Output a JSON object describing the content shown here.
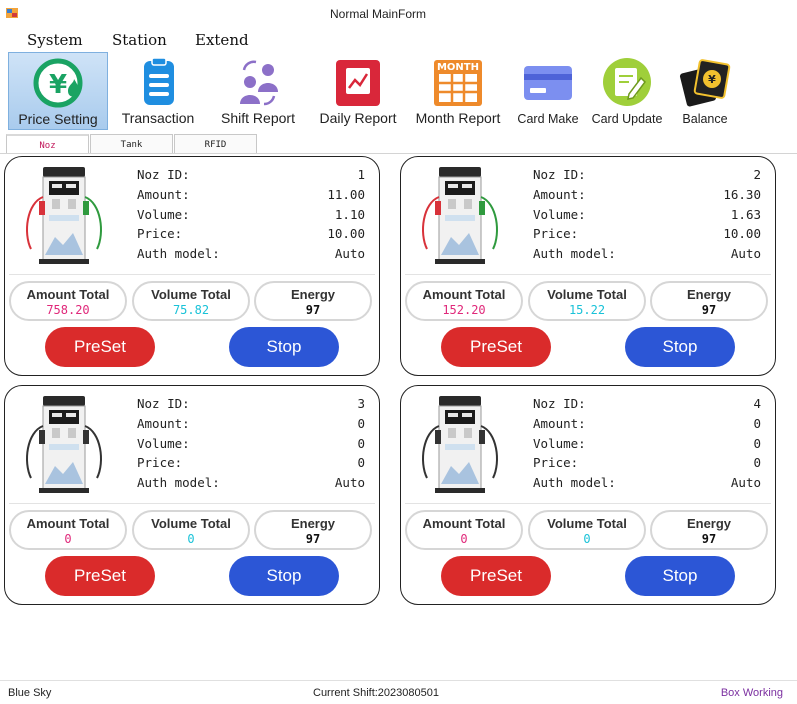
{
  "window": {
    "title": "Normal MainForm"
  },
  "menu": [
    "System",
    "Station",
    "Extend"
  ],
  "toolbar": [
    {
      "label": "Price Setting",
      "icon": "price-setting-icon"
    },
    {
      "label": "Transaction",
      "icon": "transaction-icon"
    },
    {
      "label": "Shift Report",
      "icon": "shift-report-icon"
    },
    {
      "label": "Daily Report",
      "icon": "daily-report-icon"
    },
    {
      "label": "Month Report",
      "icon": "month-report-icon",
      "badge": "MONTH"
    },
    {
      "label": "Card Make",
      "icon": "card-make-icon"
    },
    {
      "label": "Card Update",
      "icon": "card-update-icon"
    },
    {
      "label": "Balance",
      "icon": "balance-icon"
    }
  ],
  "price_icon_symbol": "¥",
  "tabs": [
    "Noz",
    "Tank",
    "RFID"
  ],
  "labels": {
    "noz_id": "Noz ID:",
    "amount": "Amount:",
    "volume": "Volume:",
    "price": "Price:",
    "auth_model": "Auth model:",
    "amount_total": "Amount Total",
    "volume_total": "Volume Total",
    "energy": "Energy",
    "preset": "PreSet",
    "stop": "Stop"
  },
  "nozzles": [
    {
      "noz_id": "1",
      "amount": "11.00",
      "volume": "1.10",
      "price": "10.00",
      "auth_model": "Auto",
      "amount_total": "758.20",
      "volume_total": "75.82",
      "energy": "97",
      "color": true
    },
    {
      "noz_id": "2",
      "amount": "16.30",
      "volume": "1.63",
      "price": "10.00",
      "auth_model": "Auto",
      "amount_total": "152.20",
      "volume_total": "15.22",
      "energy": "97",
      "color": true
    },
    {
      "noz_id": "3",
      "amount": "0",
      "volume": "0",
      "price": "0",
      "auth_model": "Auto",
      "amount_total": "0",
      "volume_total": "0",
      "energy": "97",
      "color": false
    },
    {
      "noz_id": "4",
      "amount": "0",
      "volume": "0",
      "price": "0",
      "auth_model": "Auto",
      "amount_total": "0",
      "volume_total": "0",
      "energy": "97",
      "color": false
    }
  ],
  "status": {
    "left": "Blue Sky",
    "shift": "Current Shift:2023080501",
    "right": "Box Working"
  },
  "colors": {
    "amount_total": "#e0287a",
    "volume_total": "#19c2d8",
    "preset": "#da2b2b",
    "stop": "#2c56d6",
    "status_right": "#7b2fa0"
  }
}
